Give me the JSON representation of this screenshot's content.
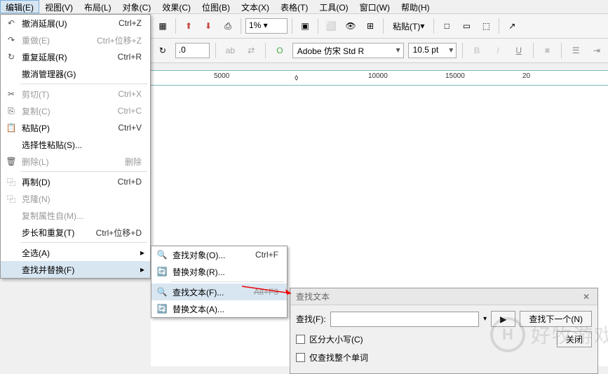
{
  "menubar": {
    "items": [
      {
        "label": "编辑(E)",
        "active": true
      },
      {
        "label": "视图(V)"
      },
      {
        "label": "布局(L)"
      },
      {
        "label": "对象(C)"
      },
      {
        "label": "效果(C)"
      },
      {
        "label": "位图(B)"
      },
      {
        "label": "文本(X)"
      },
      {
        "label": "表格(T)"
      },
      {
        "label": "工具(O)"
      },
      {
        "label": "窗口(W)"
      },
      {
        "label": "帮助(H)"
      }
    ]
  },
  "toolbar": {
    "zoom": "1%",
    "paste_label": "粘贴(T)"
  },
  "toolbar2": {
    "value": ".0",
    "font": "Adobe 仿宋 Std R",
    "size": "10.5 pt"
  },
  "edit_menu": {
    "items": [
      {
        "icon": "undo",
        "label": "撤消延展(U)",
        "shortcut": "Ctrl+Z"
      },
      {
        "icon": "redo-gray",
        "label": "重做(E)",
        "shortcut": "Ctrl+位移+Z",
        "disabled": true
      },
      {
        "icon": "redo",
        "label": "重复延展(R)",
        "shortcut": "Ctrl+R"
      },
      {
        "icon": "",
        "label": "撤消管理器(G)"
      },
      {
        "sep": true
      },
      {
        "icon": "cut",
        "label": "剪切(T)",
        "shortcut": "Ctrl+X",
        "disabled": true
      },
      {
        "icon": "copy",
        "label": "复制(C)",
        "shortcut": "Ctrl+C",
        "disabled": true
      },
      {
        "icon": "paste",
        "label": "粘贴(P)",
        "shortcut": "Ctrl+V"
      },
      {
        "icon": "",
        "label": "选择性粘贴(S)..."
      },
      {
        "icon": "delete",
        "label": "删除(L)",
        "shortcut": "删除",
        "disabled": true
      },
      {
        "sep": true
      },
      {
        "icon": "duplicate",
        "label": "再制(D)",
        "shortcut": "Ctrl+D"
      },
      {
        "icon": "clone",
        "label": "克隆(N)",
        "disabled": true
      },
      {
        "icon": "",
        "label": "复制属性自(M)...",
        "disabled": true
      },
      {
        "icon": "",
        "label": "步长和重复(T)",
        "shortcut": "Ctrl+位移+D"
      },
      {
        "sep": true
      },
      {
        "icon": "",
        "label": "全选(A)",
        "arrow": true
      },
      {
        "icon": "",
        "label": "查找并替换(F)",
        "arrow": true,
        "highlight": true
      }
    ]
  },
  "sub_menu": {
    "items": [
      {
        "icon": "find-obj",
        "label": "查找对象(O)...",
        "shortcut": "Ctrl+F"
      },
      {
        "icon": "replace-obj",
        "label": "替换对象(R)..."
      },
      {
        "sep": true
      },
      {
        "icon": "find-text",
        "label": "查找文本(F)...",
        "shortcut": "Alt+F3",
        "highlight": true,
        "strike_shortcut": true
      },
      {
        "icon": "replace-text",
        "label": "替换文本(A)..."
      }
    ]
  },
  "ruler": {
    "ticks": [
      "5000",
      "10000",
      "15000",
      "20"
    ]
  },
  "dialog": {
    "title": "查找文本",
    "find_label": "查找(F):",
    "find_value": "",
    "find_next": "查找下一个(N)",
    "case_label": "区分大小写(C)",
    "whole_word": "仅查找整个单词",
    "close": "关闭"
  },
  "watermark": {
    "letter": "H",
    "text": "好牧游戏"
  }
}
